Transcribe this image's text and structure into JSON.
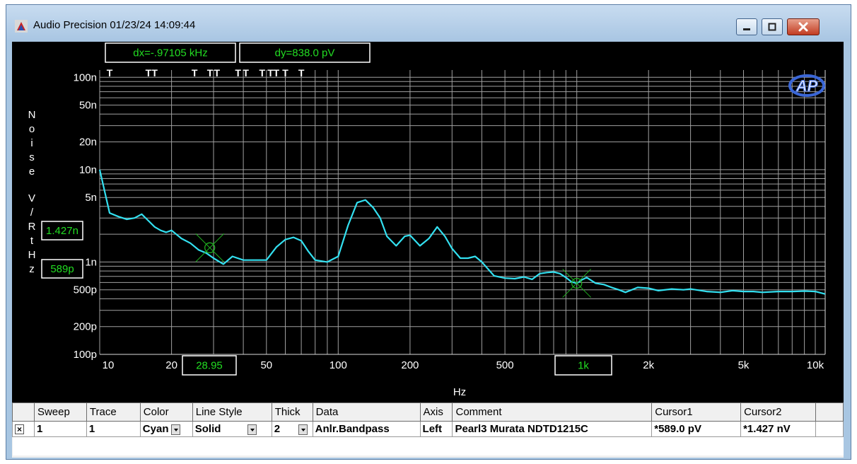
{
  "window": {
    "title": "Audio Precision  01/23/24 14:09:44",
    "app_icon": "audio-precision-app-icon",
    "controls": [
      "minimize-icon",
      "maximize-icon",
      "close-icon"
    ]
  },
  "readouts": {
    "dx": "dx=-.97105 kHz",
    "dy": "dy=838.0  pV",
    "cursor_y_high": "1.427n",
    "cursor_y_low": "589p",
    "cursor_x_low": "28.95",
    "cursor_x_high": "1k"
  },
  "logo_text": "AP",
  "colors": {
    "background": "#000000",
    "grid": "#a0a0a0",
    "trace": "#33e0f0",
    "readout_text": "#22dd22",
    "cursor": "#1fae1f"
  },
  "chart_data": {
    "type": "line",
    "x_scale": "log",
    "y_scale": "log",
    "xlim": [
      10,
      11000
    ],
    "ylim": [
      1e-10,
      1.2e-07
    ],
    "xlabel": "Hz",
    "ylabel": "Noise V/RtHz",
    "grid": true,
    "x_ticks": [
      {
        "v": 10,
        "label": "10"
      },
      {
        "v": 20,
        "label": "20"
      },
      {
        "v": 50,
        "label": "50"
      },
      {
        "v": 100,
        "label": "100"
      },
      {
        "v": 200,
        "label": "200"
      },
      {
        "v": 500,
        "label": "500"
      },
      {
        "v": 2000,
        "label": "2k"
      },
      {
        "v": 5000,
        "label": "5k"
      },
      {
        "v": 10000,
        "label": "10k"
      }
    ],
    "y_ticks": [
      {
        "v": 1e-07,
        "label": "100n"
      },
      {
        "v": 5e-08,
        "label": "50n"
      },
      {
        "v": 2e-08,
        "label": "20n"
      },
      {
        "v": 1e-08,
        "label": "10n"
      },
      {
        "v": 5e-09,
        "label": "5n"
      },
      {
        "v": 1e-09,
        "label": "1n"
      },
      {
        "v": 5e-10,
        "label": "500p"
      },
      {
        "v": 2e-10,
        "label": "200p"
      },
      {
        "v": 1e-10,
        "label": "100p"
      }
    ],
    "series": [
      {
        "color": "#33e0f0",
        "x": [
          10,
          11,
          12,
          13,
          14,
          15,
          16,
          17,
          18,
          19,
          20,
          22,
          24,
          26,
          28,
          30,
          33,
          36,
          40,
          45,
          50,
          55,
          60,
          65,
          70,
          75,
          80,
          90,
          100,
          110,
          120,
          130,
          140,
          150,
          160,
          175,
          190,
          200,
          220,
          240,
          260,
          280,
          300,
          325,
          350,
          375,
          400,
          450,
          500,
          550,
          600,
          650,
          700,
          750,
          800,
          850,
          900,
          950,
          1000,
          1050,
          1100,
          1200,
          1300,
          1400,
          1500,
          1600,
          1800,
          2000,
          2200,
          2500,
          2800,
          3000,
          3500,
          4000,
          4500,
          5000,
          5500,
          6000,
          7000,
          8000,
          9000,
          10000,
          11000
        ],
        "y": [
          1e-08,
          3.4e-09,
          3.1e-09,
          2.9e-09,
          3e-09,
          3.3e-09,
          2.8e-09,
          2.4e-09,
          2.2e-09,
          2.1e-09,
          2.2e-09,
          1.8e-09,
          1.6e-09,
          1.35e-09,
          1.25e-09,
          1.1e-09,
          9.5e-10,
          1.15e-09,
          1.05e-09,
          1.05e-09,
          1.05e-09,
          1.45e-09,
          1.75e-09,
          1.85e-09,
          1.7e-09,
          1.3e-09,
          1.05e-09,
          1e-09,
          1.15e-09,
          2.5e-09,
          4.4e-09,
          4.7e-09,
          3.9e-09,
          3e-09,
          1.9e-09,
          1.5e-09,
          1.9e-09,
          1.95e-09,
          1.5e-09,
          1.8e-09,
          2.4e-09,
          1.9e-09,
          1.4e-09,
          1.1e-09,
          1.1e-09,
          1.15e-09,
          1e-09,
          7.1e-10,
          6.7e-10,
          6.6e-10,
          6.9e-10,
          6.5e-10,
          7.5e-10,
          7.7e-10,
          7.8e-10,
          7.5e-10,
          6.8e-10,
          6.1e-10,
          5.9e-10,
          6.4e-10,
          6.8e-10,
          5.9e-10,
          5.7e-10,
          5.3e-10,
          5e-10,
          4.7e-10,
          5.3e-10,
          5.2e-10,
          4.9e-10,
          5.1e-10,
          5e-10,
          5.1e-10,
          4.8e-10,
          4.7e-10,
          4.9e-10,
          4.8e-10,
          4.8e-10,
          4.7e-10,
          4.8e-10,
          4.8e-10,
          4.85e-10,
          4.8e-10,
          4.5e-10
        ]
      }
    ],
    "cursors": [
      {
        "x": 28.95,
        "y": 1.427e-09
      },
      {
        "x": 1000,
        "y": 5.89e-10
      }
    ],
    "markers_x": [
      11,
      16,
      17,
      25,
      29,
      31,
      38,
      41,
      48,
      52,
      55,
      60,
      70
    ]
  },
  "table": {
    "headers": [
      "",
      "Sweep",
      "Trace",
      "Color",
      "Line Style",
      "Thick",
      "Data",
      "Axis",
      "Comment",
      "Cursor1",
      "Cursor2",
      ""
    ],
    "rows": [
      {
        "checked": "×",
        "sweep": "1",
        "trace": "1",
        "color": "Cyan",
        "line_style": "Solid",
        "thick": "2",
        "data": "Anlr.Bandpass",
        "axis": "Left",
        "comment": "Pearl3 Murata NDTD1215C",
        "cursor1": "*589.0  pV",
        "cursor2": "*1.427  nV"
      }
    ]
  }
}
